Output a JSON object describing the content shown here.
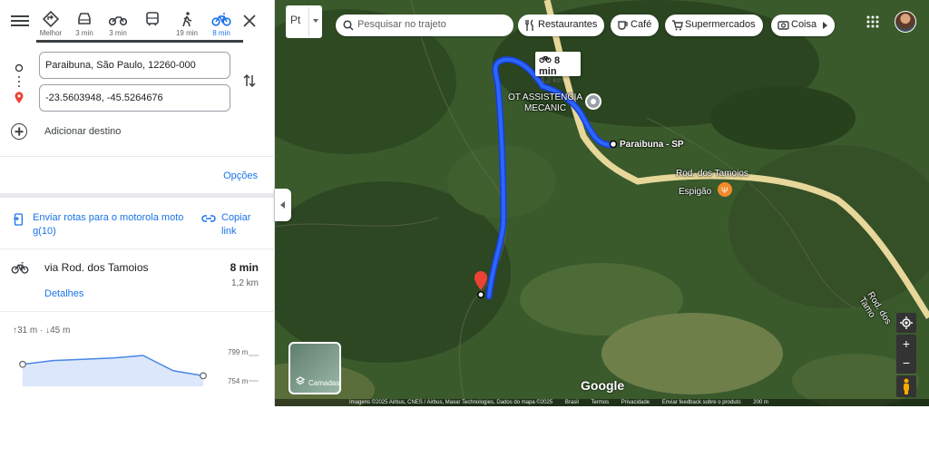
{
  "modes": [
    {
      "name": "best",
      "label": "Melhor"
    },
    {
      "name": "car",
      "label": "3 min"
    },
    {
      "name": "motorcycle",
      "label": "3 min"
    },
    {
      "name": "transit",
      "label": ""
    },
    {
      "name": "walk",
      "label": "19 min"
    },
    {
      "name": "bike",
      "label": "8 min",
      "active": true
    }
  ],
  "origin": {
    "value": "Paraibuna, São Paulo, 12260-000"
  },
  "destination": {
    "value": "-23.5603948, -45.5264676"
  },
  "add_destination": "Adicionar destino",
  "options_label": "Opções",
  "send": {
    "label": "Enviar rotas para o motorola moto g(10)"
  },
  "copy": {
    "label": "Copiar link"
  },
  "route": {
    "name": "via Rod. dos Tamoios",
    "time": "8 min",
    "distance": "1,2 km",
    "details": "Detalhes"
  },
  "elevation": {
    "summary": "↑31 m · ↓45 m",
    "max_label": "799 m",
    "min_label": "754 m",
    "profile": [
      0.35,
      0.2,
      0.15,
      0.1,
      0.0,
      0.6,
      0.8
    ]
  },
  "map": {
    "search_placeholder": "Pesquisar no trajeto",
    "lang": "Pt",
    "chips": [
      "Restaurantes",
      "Café",
      "Supermercados",
      "Coisa"
    ],
    "labels": {
      "poi": "OT ASSISTENCIA MECANIC",
      "town": "Paraibuna - SP",
      "road1": "Rod. dos Tamoios",
      "espigao": "Espigão",
      "road2": "Rod. dos Tamo"
    },
    "route_bubble": {
      "time": "8 min",
      "distance": "1,2 km"
    },
    "layers_label": "Camadas",
    "brand": "Google",
    "footer": [
      "Imagens ©2025 Airbus, CNES / Airbus, Maxar Technologies, Dados do mapa ©2025",
      "Brasil",
      "Termos",
      "Privacidade",
      "Enviar feedback sobre o produto",
      "200 m"
    ]
  },
  "colors": {
    "accent": "#1a73e8",
    "route": "#1a56ff",
    "road": "#e7d79a"
  }
}
